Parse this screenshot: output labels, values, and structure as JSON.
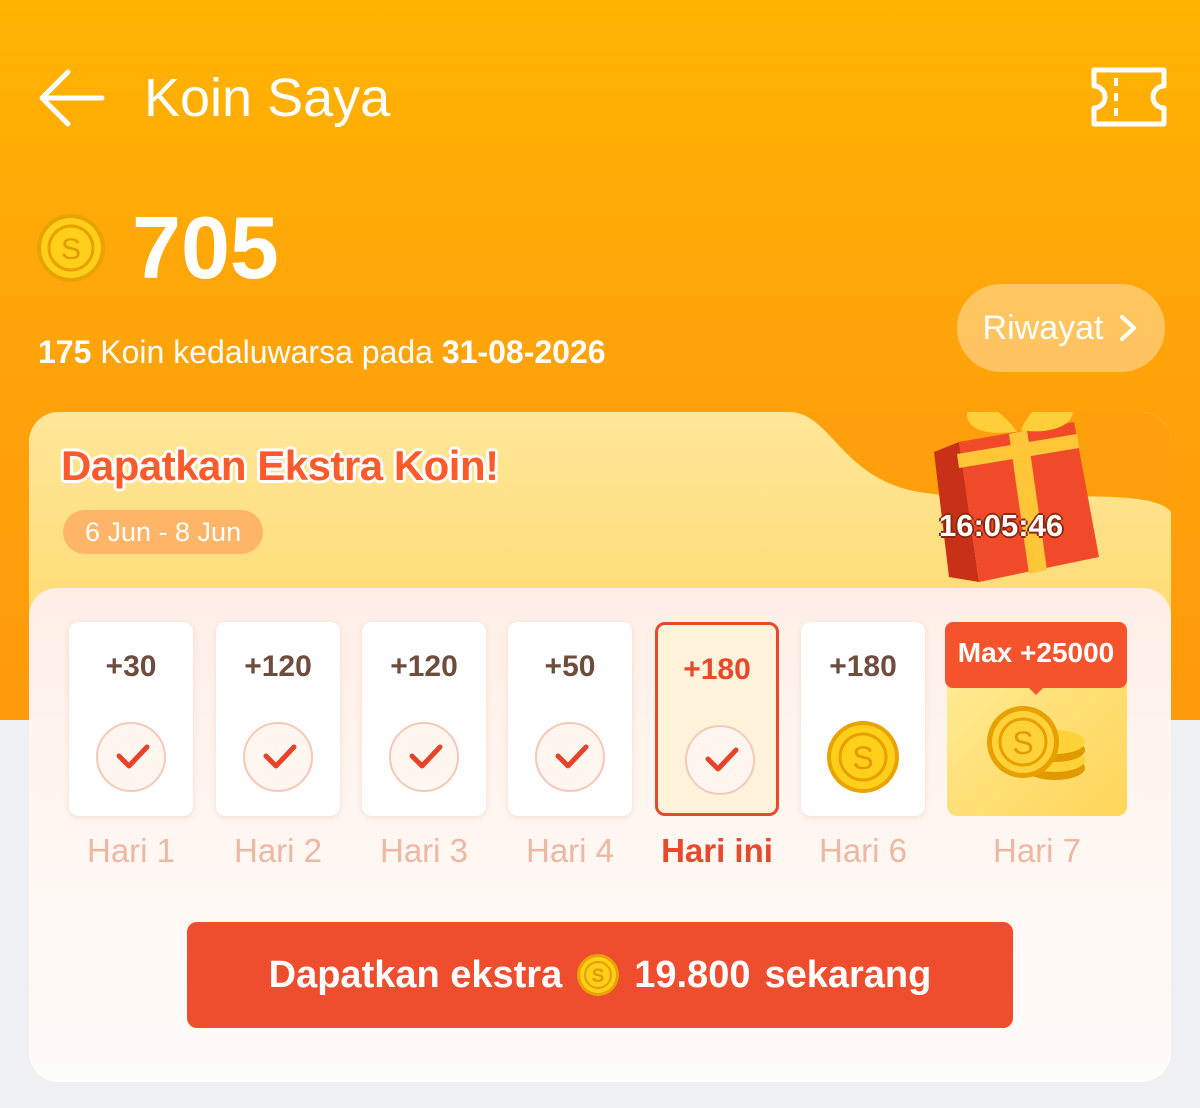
{
  "header": {
    "title": "Koin Saya",
    "back_icon": "arrow-left-icon",
    "voucher_icon": "ticket-icon"
  },
  "balance": {
    "coin_icon": "coin-icon",
    "value": "705",
    "expiry_amount": "175",
    "expiry_text": "Koin kedaluwarsa pada",
    "expiry_date": "31-08-2026",
    "history_label": "Riwayat",
    "history_icon": "chevron-right-icon"
  },
  "promo": {
    "title": "Dapatkan Ekstra Koin!",
    "date_range": "6 Jun - 8 Jun",
    "countdown": "16:05:46",
    "gift_icon": "gift-box-icon",
    "days": [
      {
        "amount": "+30",
        "label": "Hari 1",
        "state": "claimed"
      },
      {
        "amount": "+120",
        "label": "Hari 2",
        "state": "claimed"
      },
      {
        "amount": "+120",
        "label": "Hari 3",
        "state": "claimed"
      },
      {
        "amount": "+50",
        "label": "Hari 4",
        "state": "claimed"
      },
      {
        "amount": "+180",
        "label": "Hari ini",
        "state": "today-claimed"
      },
      {
        "amount": "+180",
        "label": "Hari 6",
        "state": "upcoming"
      }
    ],
    "day7": {
      "badge": "Max +25000",
      "label": "Hari 7"
    },
    "cta": {
      "label_prefix": "Dapatkan ekstra",
      "amount": "19.800",
      "label_suffix": "sekarang"
    }
  },
  "colors": {
    "header_orange": "#ffa40a",
    "accent_red": "#ee4e2d",
    "day_label": "#ecb7a3",
    "coin_gold": "#f5b800"
  }
}
